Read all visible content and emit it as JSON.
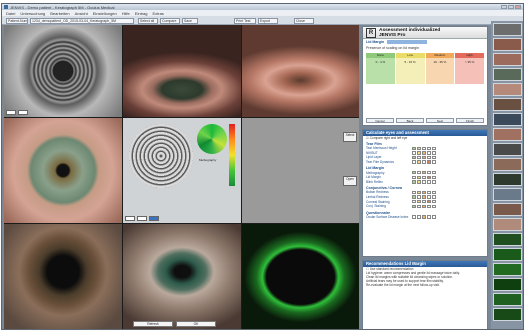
{
  "window": {
    "title": "JENVIS - Demo patient - Keratograph 5M - Oculus Medical",
    "menu": [
      "Datei",
      "Untersuchung",
      "Bearbeiten",
      "Ansicht",
      "Einstellungen",
      "Hilfe",
      "Eintrag",
      "Extras"
    ]
  },
  "toolbar": {
    "field1": "Patient-Nummer",
    "field2": "1234_demopatient_OD_2015-03-04_Keratograph_5M",
    "btn1": "Select all",
    "btn2": "Compare",
    "btn3": "Save",
    "btn4": "Print Test",
    "btn5": "Export",
    "btn6": "Close"
  },
  "viewer": {
    "map_info": "Meibography",
    "side_btn1": "Select",
    "side_btn2": "Open",
    "bottom_btn1": "Refresh",
    "bottom_btn2": "OK"
  },
  "assessment": {
    "title_line1": "Assessment individualized",
    "title_line2": "JENVIS Pro",
    "badge": "R",
    "lid_margin_label": "Lid Margin",
    "subtitle": "Presence of scaling on lid margin",
    "grades": [
      {
        "head": "None",
        "body": "0 - 4 %"
      },
      {
        "head": "Low",
        "body": "5 - 15 %"
      },
      {
        "head": "Medium",
        "body": "16 - 35 %"
      },
      {
        "head": "High",
        "body": "> 35 %"
      }
    ],
    "footer": [
      "Cancel",
      "Back",
      "Next",
      "Finish"
    ]
  },
  "calculate": {
    "header": "Calculate eyes and assessment",
    "checkbox": "Compare right and left eye",
    "tear_film_heading": "Tear Film",
    "tear_film_rows": [
      "Tear Meniscus Height",
      "NIKBUT",
      "Lipid Layer",
      "Tear Film Dynamics"
    ],
    "lid_heading": "Lid Margin",
    "lid_rows": [
      "Meibography",
      "Lid Margin",
      "Blink Reflex"
    ],
    "cornea_heading": "Conjunctiva / Cornea",
    "cornea_rows": [
      "Bulbar Redness",
      "Limbal Redness",
      "Corneal Staining",
      "Conj. Staining"
    ],
    "q_heading": "Questionnaire",
    "q_rows": [
      "Ocular Surface Disease Index"
    ]
  },
  "recommend": {
    "header": "Recommendations Lid Margin",
    "checkbox": "Use standard recommendation",
    "lines": [
      "Lid hygiene: warm compresses and gentle lid massage twice daily.",
      "Clean lid margins with suitable lid cleansing wipes or solution.",
      "Artificial tears may be used to support tear film stability.",
      "Re-evaluate the lid margin at the next follow-up visit."
    ]
  }
}
